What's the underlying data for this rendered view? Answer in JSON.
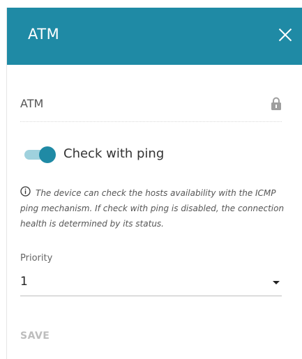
{
  "header": {
    "title": "ATM"
  },
  "fields": {
    "atm_value": "ATM"
  },
  "ping": {
    "label": "Check with ping",
    "enabled": true,
    "info": "The device can check the hosts availability with the ICMP ping mechanism. If check with ping is disabled, the connection health is determined by its status."
  },
  "priority": {
    "label": "Priority",
    "value": "1"
  },
  "actions": {
    "save_label": "SAVE"
  },
  "colors": {
    "accent": "#1f8aa5",
    "toggle_track": "#9fd1dd",
    "disabled_text": "#bdbdbd"
  },
  "icons": {
    "close": "close-icon",
    "lock": "lock-icon",
    "info": "info-icon",
    "dropdown": "chevron-down-icon"
  }
}
